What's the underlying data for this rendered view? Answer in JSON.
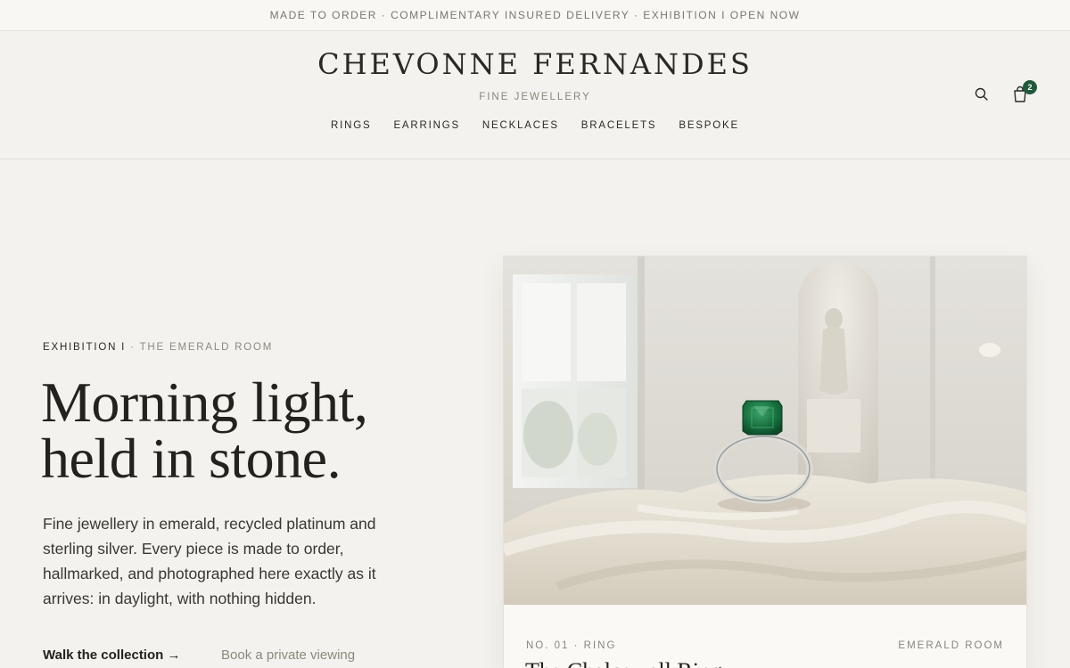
{
  "announcement": "MADE TO ORDER · COMPLIMENTARY INSURED DELIVERY · EXHIBITION I OPEN NOW",
  "header": {
    "brand": "CHEVONNE FERNANDES",
    "tagline": "FINE JEWELLERY",
    "nav": [
      "RINGS",
      "EARRINGS",
      "NECKLACES",
      "BRACELETS",
      "BESPOKE"
    ],
    "search_icon": "search-icon",
    "cart_icon": "shopping-bag-icon",
    "cart_count": "2"
  },
  "hero": {
    "eyebrow_main": "EXHIBITION I",
    "eyebrow_sub": "· THE EMERALD ROOM",
    "title_line1": "Morning light,",
    "title_line2": "held in stone.",
    "body": "Fine jewellery in emerald, recycled platinum and sterling silver. Every piece is made to order, hallmarked, and photographed here exactly as it arrives: in daylight, with nothing hidden.",
    "cta_primary": "Walk the collection →",
    "cta_secondary": "Book a private viewing"
  },
  "feature_card": {
    "meta": "NO. 01 · RING",
    "room": "EMERALD ROOM",
    "title": "The Chalcewell Ring"
  },
  "colors": {
    "background": "#f4f2ee",
    "accent": "#1f5a3a",
    "text": "#26241f",
    "muted": "#8a857c"
  }
}
